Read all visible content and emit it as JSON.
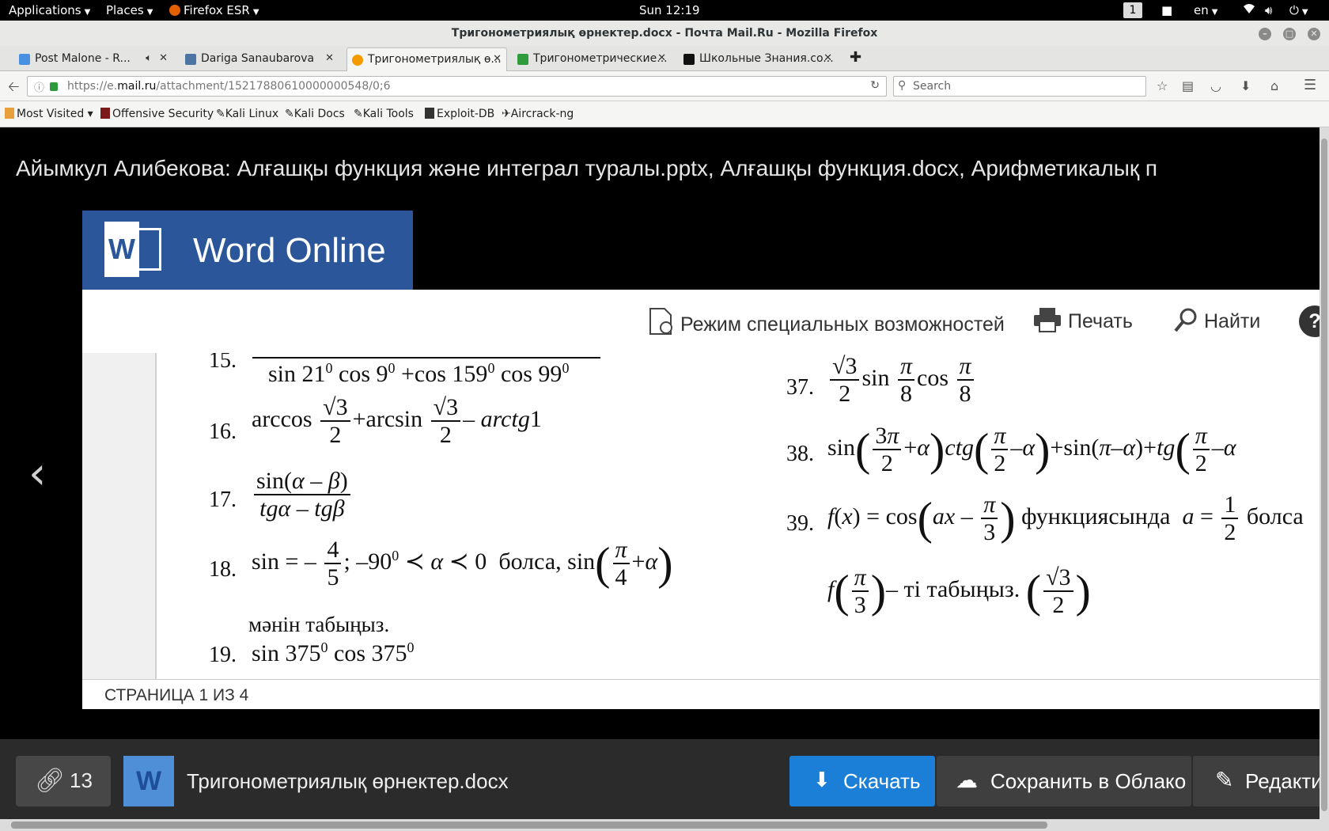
{
  "topbar": {
    "applications": "Applications",
    "places": "Places",
    "browser": "Firefox ESR",
    "clock": "Sun 12:19",
    "workspace": "1",
    "lang": "en"
  },
  "window": {
    "title": "Тригонометриялық өрнектер.docx - Почта Mail.Ru - Mozilla Firefox"
  },
  "tabs": [
    {
      "label": "Post Malone - R...",
      "close": "✕"
    },
    {
      "label": "Dariga Sanaubarova",
      "close": "✕"
    },
    {
      "label": "Тригонометриялық ө...",
      "close": "✕"
    },
    {
      "label": "Тригонометрические...",
      "close": "✕"
    },
    {
      "label": "Школьные Знания.co...",
      "close": "✕"
    }
  ],
  "navbar": {
    "url_prefix": "https://e.",
    "url_domain": "mail.ru",
    "url_path": "/attachment/15217880610000000548/0;6",
    "search_placeholder": "Search"
  },
  "bookmarks": [
    {
      "label": "Most Visited ▾"
    },
    {
      "label": "Offensive Security"
    },
    {
      "label": "Kali Linux"
    },
    {
      "label": "Kali Docs"
    },
    {
      "label": "Kali Tools"
    },
    {
      "label": "Exploit-DB"
    },
    {
      "label": "Aircrack-ng"
    }
  ],
  "mail": {
    "header": "Айымкул Алибекова: Алғашқы функция және интеграл туралы.pptx, Алғашқы функция.docx, Арифметикалық п"
  },
  "word": {
    "app_title": "Word Online",
    "logo_letter": "W",
    "toolbar": {
      "accessibility": "Режим специальных возможностей",
      "print": "Печать",
      "find": "Найти",
      "help": "?"
    },
    "page_indicator": "СТРАНИЦА 1 ИЗ 4",
    "problems": {
      "n15": "15.",
      "n16": "16.",
      "n17": "17.",
      "n18": "18.",
      "n18_text": "болса,",
      "n18_line2": "мәнін табыңыз.",
      "n19": "19.",
      "n37": "37.",
      "n38": "38.",
      "n39": "39.",
      "n39_text": "функциясында",
      "n39_text2": "болса",
      "n39_line2": "– ті табыңыз."
    }
  },
  "actions": {
    "attachments_count": "13",
    "file_letter": "W",
    "file_name": "Тригонометриялық өрнектер.docx",
    "download": "Скачать",
    "save_cloud": "Сохранить в Облако",
    "edit": "Редакти"
  },
  "colors": {
    "word_blue": "#2b579a",
    "download_blue": "#1b7fd7",
    "action_bar": "#2b2b2b"
  }
}
